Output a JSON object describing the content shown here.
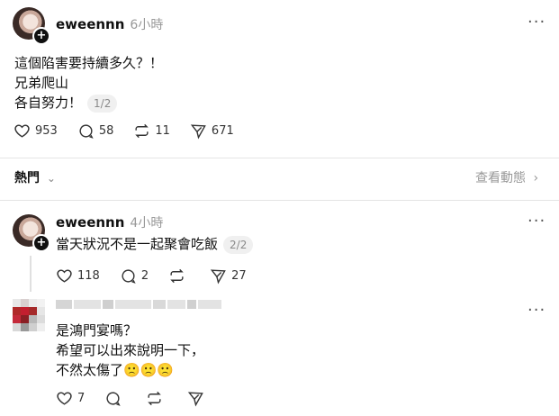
{
  "post": {
    "username": "eweennn",
    "time": "6小時",
    "more": "···",
    "lines": [
      "這個陷害要持續多久？！",
      "兄弟爬山",
      "各自努力！"
    ],
    "page_badge": "1/2",
    "likes": "953",
    "comments": "58",
    "reposts": "11",
    "shares": "671"
  },
  "section": {
    "label": "熱門",
    "view_activity": "查看動態"
  },
  "reply1": {
    "username": "eweennn",
    "time": "4小時",
    "more": "···",
    "text": "當天狀況不是一起聚會吃飯",
    "page_badge": "2/2",
    "likes": "118",
    "comments": "2",
    "shares": "27"
  },
  "reply2": {
    "more": "···",
    "lines": [
      "是鴻門宴嗎？",
      "希望可以出來說明一下，",
      "不然太傷了"
    ],
    "emojis": "🙁🙁🙁",
    "likes": "7"
  }
}
